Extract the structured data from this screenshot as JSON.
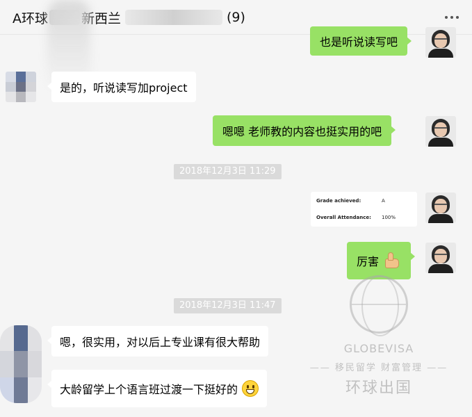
{
  "header": {
    "title_prefix": "A环球",
    "title_middle": "新西兰",
    "member_count": "(9)",
    "menu_icon": "more-dots-icon"
  },
  "messages": [
    {
      "side": "me",
      "text": "也是听说读写吧"
    },
    {
      "side": "them",
      "text": "是的，听说读写加project"
    },
    {
      "side": "me",
      "text": "嗯嗯 老师教的内容也挺实用的吧"
    },
    {
      "side": "me",
      "text": "厉害",
      "emoji": "thumbs-up-icon"
    },
    {
      "side": "them",
      "text": "嗯，很实用，对以后上专业课有很大帮助"
    },
    {
      "side": "them",
      "text": "大龄留学上个语言班过渡一下挺好的",
      "emoji": "grinning-face-icon"
    }
  ],
  "timestamps": [
    "2018年12月3日 11:29",
    "2018年12月3日 11:47"
  ],
  "grade_card": {
    "grade_label": "Grade achieved:",
    "grade_value": "A",
    "attendance_label": "Overall Attendance:",
    "attendance_value": "100%"
  },
  "watermark": {
    "brand": "GLOBEVISA",
    "tagline": "—— 移民留学 财富管理 ——",
    "chinese_name": "环球出国"
  },
  "colors": {
    "background": "#f5f5f5",
    "my_bubble": "#98e165",
    "their_bubble": "#ffffff",
    "timestamp_pill": "#dadada"
  }
}
